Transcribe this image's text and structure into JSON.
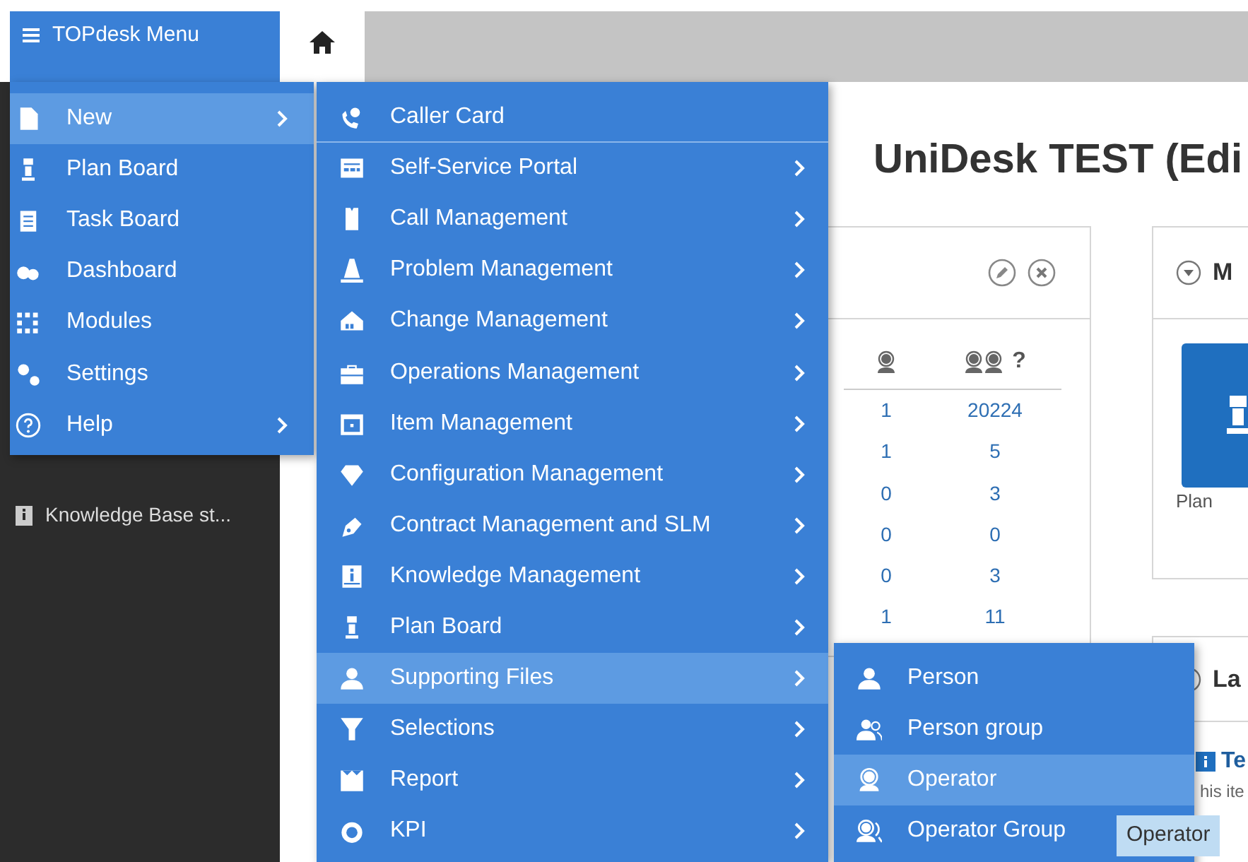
{
  "menu_button": {
    "label": "TOPdesk Menu"
  },
  "main_menu": [
    {
      "label": "New",
      "selected": true,
      "has_submenu": true
    },
    {
      "label": "Plan Board",
      "selected": false,
      "has_submenu": false
    },
    {
      "label": "Task Board",
      "selected": false,
      "has_submenu": false
    },
    {
      "label": "Dashboard",
      "selected": false,
      "has_submenu": false
    },
    {
      "label": "Modules",
      "selected": false,
      "has_submenu": false
    },
    {
      "label": "Settings",
      "selected": false,
      "has_submenu": false
    },
    {
      "label": "Help",
      "selected": false,
      "has_submenu": true
    }
  ],
  "new_submenu": [
    {
      "label": "Caller Card",
      "selected": false,
      "has_submenu": false,
      "divider_after": true
    },
    {
      "label": "Self-Service Portal",
      "selected": false,
      "has_submenu": true,
      "divider_after": false
    },
    {
      "label": "Call Management",
      "selected": false,
      "has_submenu": true,
      "divider_after": false
    },
    {
      "label": "Problem Management",
      "selected": false,
      "has_submenu": true,
      "divider_after": false
    },
    {
      "label": "Change Management",
      "selected": false,
      "has_submenu": true,
      "divider_after": false
    },
    {
      "label": "Operations Management",
      "selected": false,
      "has_submenu": true,
      "divider_after": false
    },
    {
      "label": "Item Management",
      "selected": false,
      "has_submenu": true,
      "divider_after": false
    },
    {
      "label": "Configuration Management",
      "selected": false,
      "has_submenu": true,
      "divider_after": false
    },
    {
      "label": "Contract Management and SLM",
      "selected": false,
      "has_submenu": true,
      "divider_after": false
    },
    {
      "label": "Knowledge Management",
      "selected": false,
      "has_submenu": true,
      "divider_after": false
    },
    {
      "label": "Plan Board",
      "selected": false,
      "has_submenu": true,
      "divider_after": false
    },
    {
      "label": "Supporting Files",
      "selected": true,
      "has_submenu": true,
      "divider_after": false
    },
    {
      "label": "Selections",
      "selected": false,
      "has_submenu": true,
      "divider_after": false
    },
    {
      "label": "Report",
      "selected": false,
      "has_submenu": true,
      "divider_after": false
    },
    {
      "label": "KPI",
      "selected": false,
      "has_submenu": true,
      "divider_after": false
    }
  ],
  "supporting_files_submenu": [
    {
      "label": "Person",
      "selected": false
    },
    {
      "label": "Person group",
      "selected": false
    },
    {
      "label": "Operator",
      "selected": true
    },
    {
      "label": "Operator Group",
      "selected": false
    }
  ],
  "tooltip": "Operator",
  "sidebar": {
    "items": [
      {
        "label": "Knowledge Base st..."
      }
    ]
  },
  "page_title": "UniDesk TEST (Edi",
  "counts_card": {
    "column_2_header": "?",
    "rows": [
      [
        "1",
        "20224"
      ],
      [
        "1",
        "5"
      ],
      [
        "0",
        "3"
      ],
      [
        "0",
        "0"
      ],
      [
        "0",
        "3"
      ],
      [
        "1",
        "11"
      ]
    ]
  },
  "modules_card": {
    "title": "M",
    "tile_label": "Plan"
  },
  "latest_card": {
    "title": "La",
    "item_title": "Te",
    "item_text": "his ite"
  }
}
